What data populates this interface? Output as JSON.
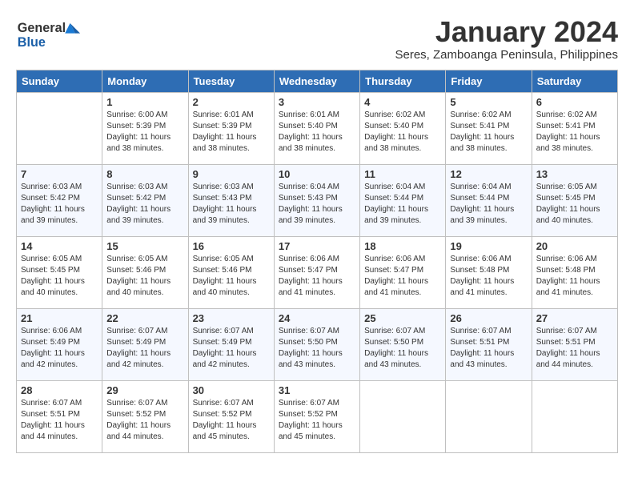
{
  "header": {
    "logo_line1": "General",
    "logo_line2": "Blue",
    "month": "January 2024",
    "location": "Seres, Zamboanga Peninsula, Philippines"
  },
  "columns": [
    "Sunday",
    "Monday",
    "Tuesday",
    "Wednesday",
    "Thursday",
    "Friday",
    "Saturday"
  ],
  "weeks": [
    [
      {
        "day": "",
        "info": ""
      },
      {
        "day": "1",
        "info": "Sunrise: 6:00 AM\nSunset: 5:39 PM\nDaylight: 11 hours and 38 minutes."
      },
      {
        "day": "2",
        "info": "Sunrise: 6:01 AM\nSunset: 5:39 PM\nDaylight: 11 hours and 38 minutes."
      },
      {
        "day": "3",
        "info": "Sunrise: 6:01 AM\nSunset: 5:40 PM\nDaylight: 11 hours and 38 minutes."
      },
      {
        "day": "4",
        "info": "Sunrise: 6:02 AM\nSunset: 5:40 PM\nDaylight: 11 hours and 38 minutes."
      },
      {
        "day": "5",
        "info": "Sunrise: 6:02 AM\nSunset: 5:41 PM\nDaylight: 11 hours and 38 minutes."
      },
      {
        "day": "6",
        "info": "Sunrise: 6:02 AM\nSunset: 5:41 PM\nDaylight: 11 hours and 38 minutes."
      }
    ],
    [
      {
        "day": "7",
        "info": "Sunrise: 6:03 AM\nSunset: 5:42 PM\nDaylight: 11 hours and 39 minutes."
      },
      {
        "day": "8",
        "info": "Sunrise: 6:03 AM\nSunset: 5:42 PM\nDaylight: 11 hours and 39 minutes."
      },
      {
        "day": "9",
        "info": "Sunrise: 6:03 AM\nSunset: 5:43 PM\nDaylight: 11 hours and 39 minutes."
      },
      {
        "day": "10",
        "info": "Sunrise: 6:04 AM\nSunset: 5:43 PM\nDaylight: 11 hours and 39 minutes."
      },
      {
        "day": "11",
        "info": "Sunrise: 6:04 AM\nSunset: 5:44 PM\nDaylight: 11 hours and 39 minutes."
      },
      {
        "day": "12",
        "info": "Sunrise: 6:04 AM\nSunset: 5:44 PM\nDaylight: 11 hours and 39 minutes."
      },
      {
        "day": "13",
        "info": "Sunrise: 6:05 AM\nSunset: 5:45 PM\nDaylight: 11 hours and 40 minutes."
      }
    ],
    [
      {
        "day": "14",
        "info": "Sunrise: 6:05 AM\nSunset: 5:45 PM\nDaylight: 11 hours and 40 minutes."
      },
      {
        "day": "15",
        "info": "Sunrise: 6:05 AM\nSunset: 5:46 PM\nDaylight: 11 hours and 40 minutes."
      },
      {
        "day": "16",
        "info": "Sunrise: 6:05 AM\nSunset: 5:46 PM\nDaylight: 11 hours and 40 minutes."
      },
      {
        "day": "17",
        "info": "Sunrise: 6:06 AM\nSunset: 5:47 PM\nDaylight: 11 hours and 41 minutes."
      },
      {
        "day": "18",
        "info": "Sunrise: 6:06 AM\nSunset: 5:47 PM\nDaylight: 11 hours and 41 minutes."
      },
      {
        "day": "19",
        "info": "Sunrise: 6:06 AM\nSunset: 5:48 PM\nDaylight: 11 hours and 41 minutes."
      },
      {
        "day": "20",
        "info": "Sunrise: 6:06 AM\nSunset: 5:48 PM\nDaylight: 11 hours and 41 minutes."
      }
    ],
    [
      {
        "day": "21",
        "info": "Sunrise: 6:06 AM\nSunset: 5:49 PM\nDaylight: 11 hours and 42 minutes."
      },
      {
        "day": "22",
        "info": "Sunrise: 6:07 AM\nSunset: 5:49 PM\nDaylight: 11 hours and 42 minutes."
      },
      {
        "day": "23",
        "info": "Sunrise: 6:07 AM\nSunset: 5:49 PM\nDaylight: 11 hours and 42 minutes."
      },
      {
        "day": "24",
        "info": "Sunrise: 6:07 AM\nSunset: 5:50 PM\nDaylight: 11 hours and 43 minutes."
      },
      {
        "day": "25",
        "info": "Sunrise: 6:07 AM\nSunset: 5:50 PM\nDaylight: 11 hours and 43 minutes."
      },
      {
        "day": "26",
        "info": "Sunrise: 6:07 AM\nSunset: 5:51 PM\nDaylight: 11 hours and 43 minutes."
      },
      {
        "day": "27",
        "info": "Sunrise: 6:07 AM\nSunset: 5:51 PM\nDaylight: 11 hours and 44 minutes."
      }
    ],
    [
      {
        "day": "28",
        "info": "Sunrise: 6:07 AM\nSunset: 5:51 PM\nDaylight: 11 hours and 44 minutes."
      },
      {
        "day": "29",
        "info": "Sunrise: 6:07 AM\nSunset: 5:52 PM\nDaylight: 11 hours and 44 minutes."
      },
      {
        "day": "30",
        "info": "Sunrise: 6:07 AM\nSunset: 5:52 PM\nDaylight: 11 hours and 45 minutes."
      },
      {
        "day": "31",
        "info": "Sunrise: 6:07 AM\nSunset: 5:52 PM\nDaylight: 11 hours and 45 minutes."
      },
      {
        "day": "",
        "info": ""
      },
      {
        "day": "",
        "info": ""
      },
      {
        "day": "",
        "info": ""
      }
    ]
  ]
}
